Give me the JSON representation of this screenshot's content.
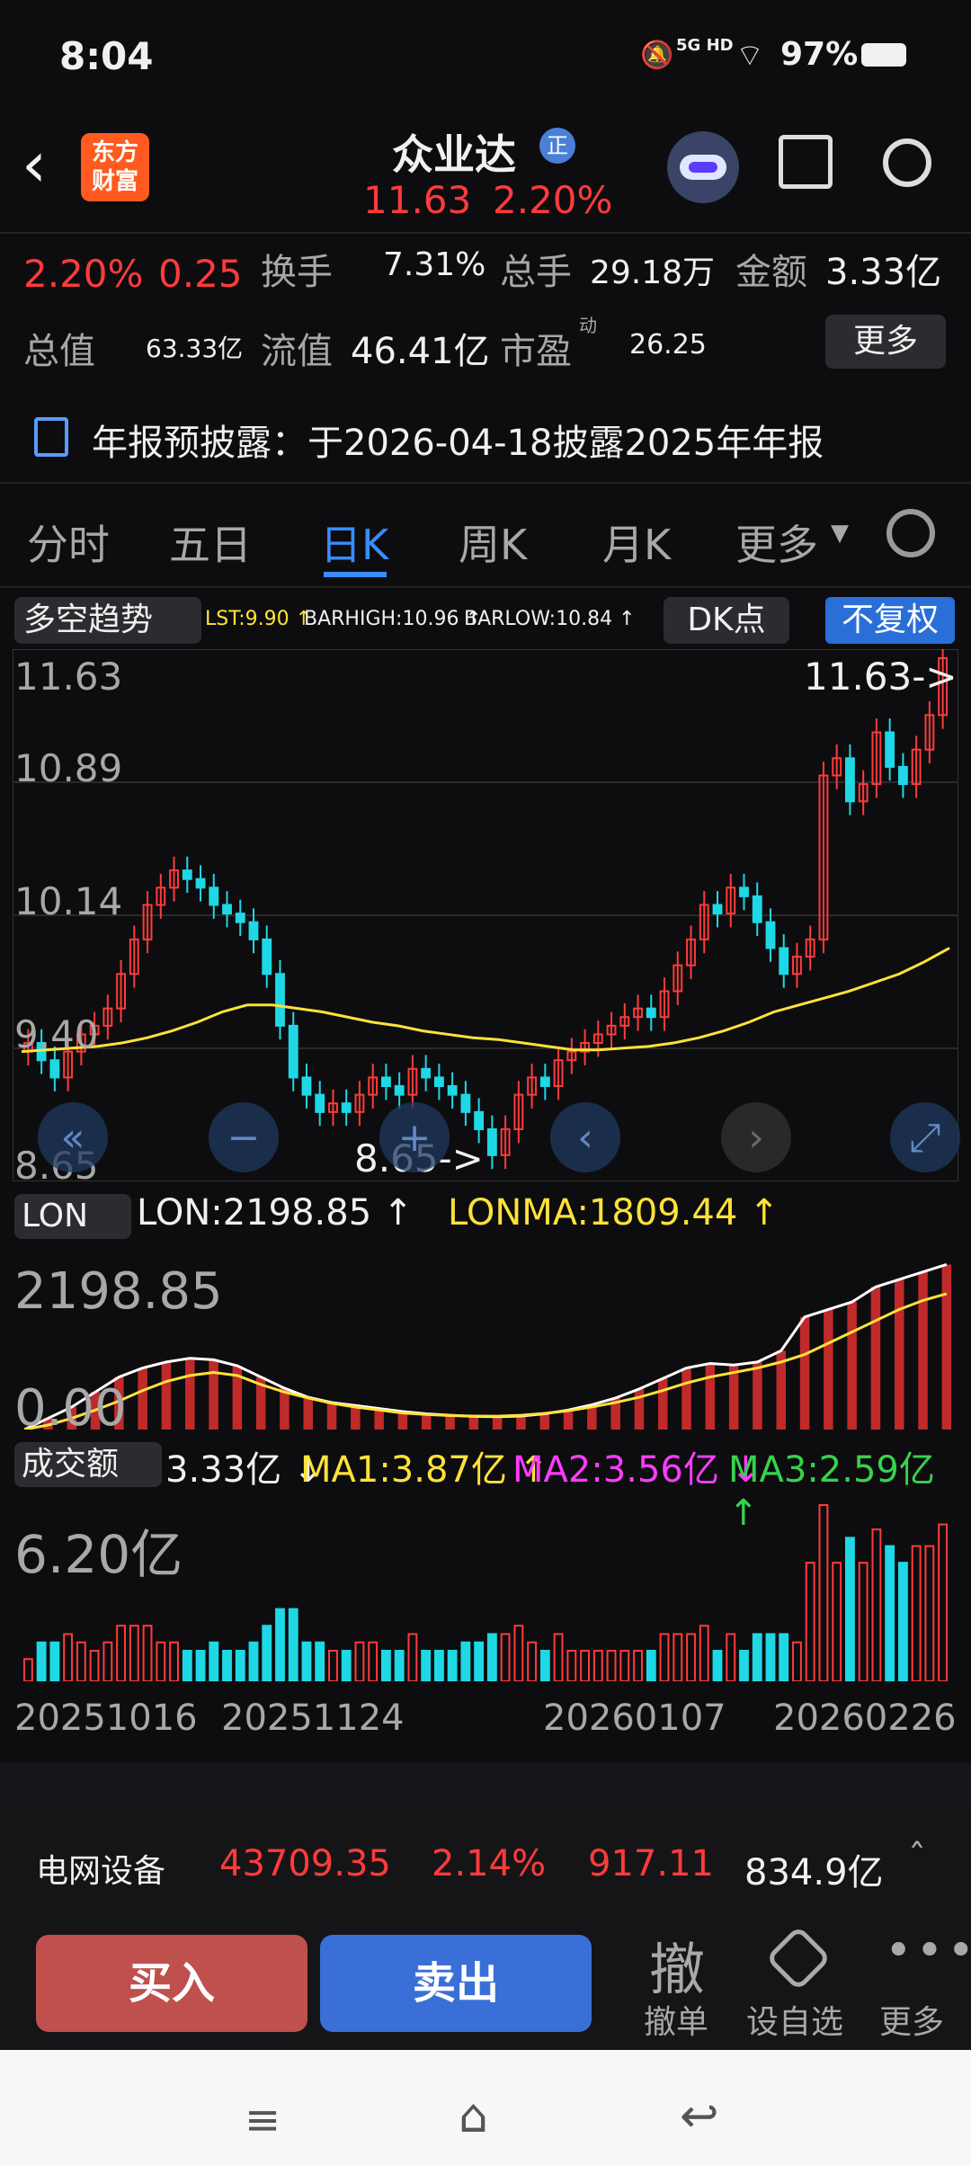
{
  "status": {
    "time": "8:04",
    "network": "5G HD",
    "battery": "97%"
  },
  "header": {
    "stock_name": "众业达",
    "badge": "正",
    "price": "11.63",
    "change_pct": "2.20%"
  },
  "quote": {
    "change_pct": "2.20%",
    "change_amt": "0.25",
    "turnover_label": "换手",
    "turnover": "7.31%",
    "volume_label": "总手",
    "volume": "29.18万",
    "amount_label": "金额",
    "amount": "3.33亿",
    "mktcap_label": "总值",
    "mktcap": "63.33亿",
    "float_label": "流值",
    "float_cap": "46.41亿",
    "pe_label": "市盈",
    "pe_sup": "动",
    "pe": "26.25",
    "more": "更多"
  },
  "notice": {
    "text": "年报预披露：于2026-04-18披露2025年年报"
  },
  "tabs": [
    "分时",
    "五日",
    "日K",
    "周K",
    "月K",
    "更多"
  ],
  "active_tab": "日K",
  "kline": {
    "indicator": "多空趋势",
    "lst": "LST:9.90 ↑",
    "barhigh": "BARHIGH:10.96 ↑",
    "barlow": "BARLOW:10.84 ↑",
    "dk_button": "DK点",
    "fq_button": "不复权",
    "y_labels": [
      "11.63",
      "10.89",
      "10.14",
      "9.40",
      "8.65"
    ],
    "high_marker": "11.63->",
    "low_marker": "8.65->"
  },
  "lon": {
    "selector": "LON",
    "lon": "LON:2198.85 ↑",
    "lonma": "LONMA:1809.44 ↑",
    "y_top": "2198.85",
    "y_bottom": "0.00"
  },
  "vol": {
    "selector": "成交额",
    "value": "3.33亿 ↓",
    "ma1": "MA1:3.87亿 ↑",
    "ma2": "MA2:3.56亿 ↓",
    "ma3": "MA3:2.59亿 ↑",
    "y_top": "6.20亿"
  },
  "x_labels": [
    "20251016",
    "20251124",
    "20260107",
    "20260226"
  ],
  "sector": {
    "name": "电网设备",
    "index": "43709.35",
    "pct": "2.14%",
    "change": "917.11",
    "amount": "834.9亿"
  },
  "actions": {
    "buy": "买入",
    "sell": "卖出",
    "cancel_big": "撤",
    "cancel": "撤单",
    "watch": "设自选",
    "more": "更多"
  },
  "brand": {
    "logo_line1": "东方",
    "logo_line2": "财富"
  },
  "colors": {
    "up": "#ff3b3b",
    "down": "#1fd8e6",
    "accent": "#3a8cff",
    "ma": "#ffe23a",
    "lonma": "#ffe23a",
    "ma2": "#ff3bff",
    "ma3": "#37d24d"
  },
  "chart_data": {
    "type": "candlestick",
    "price_range": [
      8.65,
      11.63
    ],
    "closes": [
      9.4,
      9.3,
      9.2,
      9.35,
      9.45,
      9.5,
      9.6,
      9.8,
      10.0,
      10.2,
      10.3,
      10.4,
      10.35,
      10.3,
      10.2,
      10.15,
      10.1,
      10.0,
      9.8,
      9.5,
      9.2,
      9.1,
      9.0,
      9.05,
      9.0,
      9.1,
      9.2,
      9.15,
      9.1,
      9.25,
      9.2,
      9.15,
      9.1,
      9.0,
      8.9,
      8.75,
      8.9,
      9.1,
      9.2,
      9.15,
      9.3,
      9.35,
      9.4,
      9.45,
      9.5,
      9.55,
      9.6,
      9.55,
      9.7,
      9.85,
      10.0,
      10.2,
      10.15,
      10.3,
      10.25,
      10.1,
      9.95,
      9.8,
      9.9,
      10.0,
      10.95,
      11.05,
      10.8,
      10.9,
      11.2,
      11.0,
      10.9,
      11.1,
      11.3,
      11.63
    ],
    "ma": [
      9.35,
      9.36,
      9.37,
      9.38,
      9.4,
      9.43,
      9.47,
      9.52,
      9.58,
      9.62,
      9.62,
      9.6,
      9.58,
      9.55,
      9.52,
      9.5,
      9.47,
      9.45,
      9.43,
      9.42,
      9.4,
      9.38,
      9.36,
      9.36,
      9.37,
      9.38,
      9.4,
      9.43,
      9.47,
      9.52,
      9.58,
      9.62,
      9.66,
      9.7,
      9.75,
      9.8,
      9.87,
      9.95
    ],
    "lon": [
      0,
      150,
      300,
      500,
      700,
      820,
      900,
      950,
      930,
      850,
      700,
      550,
      430,
      360,
      320,
      280,
      240,
      210,
      190,
      175,
      170,
      180,
      210,
      260,
      330,
      420,
      540,
      680,
      820,
      880,
      860,
      900,
      1050,
      1500,
      1600,
      1700,
      1900,
      2000,
      2100,
      2198.85
    ],
    "lonma": [
      0,
      60,
      150,
      260,
      380,
      520,
      640,
      720,
      760,
      720,
      600,
      500,
      420,
      350,
      300,
      260,
      220,
      200,
      185,
      180,
      178,
      190,
      215,
      250,
      300,
      360,
      430,
      520,
      620,
      700,
      760,
      820,
      900,
      1000,
      1150,
      1300,
      1450,
      1600,
      1720,
      1809.44
    ],
    "vol_max": "6.20亿"
  }
}
